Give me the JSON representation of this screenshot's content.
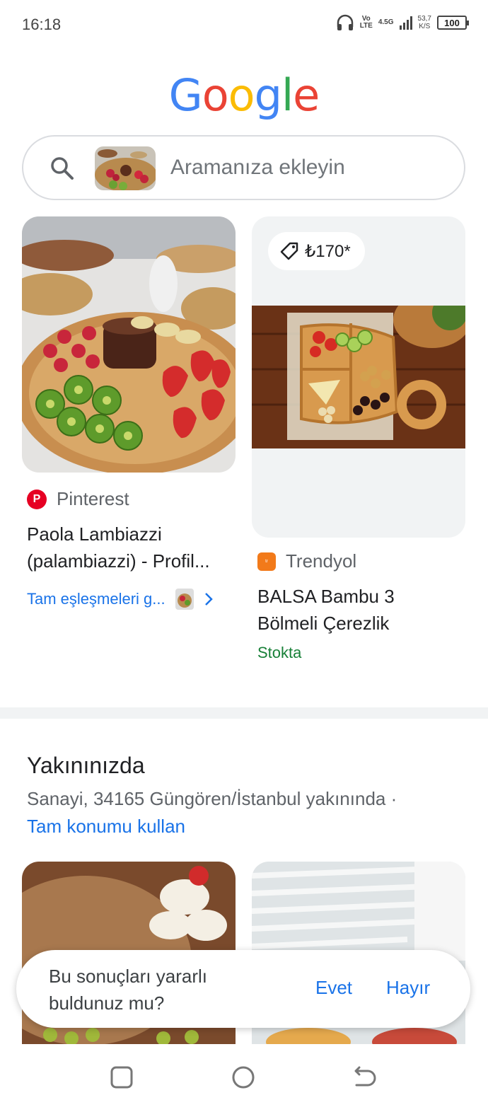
{
  "status_bar": {
    "time": "16:18",
    "volte": "Vo\nLTE",
    "network": "4.5G",
    "speed_value": "53,7",
    "speed_unit": "K/S",
    "battery": "100"
  },
  "logo": [
    "G",
    "o",
    "o",
    "g",
    "l",
    "e"
  ],
  "logo_colors": [
    "#4285F4",
    "#EA4335",
    "#FBBC05",
    "#4285F4",
    "#34A853",
    "#EA4335"
  ],
  "search": {
    "placeholder": "Aramanıza ekleyin"
  },
  "results": [
    {
      "source": "Pinterest",
      "source_color": "#E60023",
      "title_line1": "Paola Lambiazzi",
      "title_line2": "(palambiazzi) - Profil...",
      "link": "Tam eşleşmeleri g..."
    },
    {
      "price": "₺170*",
      "source": "Trendyol",
      "source_color": "#F27A1A",
      "title_line1": "BALSA Bambu 3",
      "title_line2": "Bölmeli Çerezlik",
      "availability": "Stokta"
    }
  ],
  "nearby": {
    "title": "Yakınınızda",
    "location": "Sanayi, 34165 Güngören/İstanbul yakınında ·",
    "link": "Tam konumu kullan"
  },
  "feedback": {
    "question_line1": "Bu sonuçları yararlı",
    "question_line2": "buldunuz mu?",
    "yes": "Evet",
    "no": "Hayır"
  },
  "nav": {
    "recents": "square-icon",
    "home": "circle-icon",
    "back": "back-arrow-icon"
  }
}
